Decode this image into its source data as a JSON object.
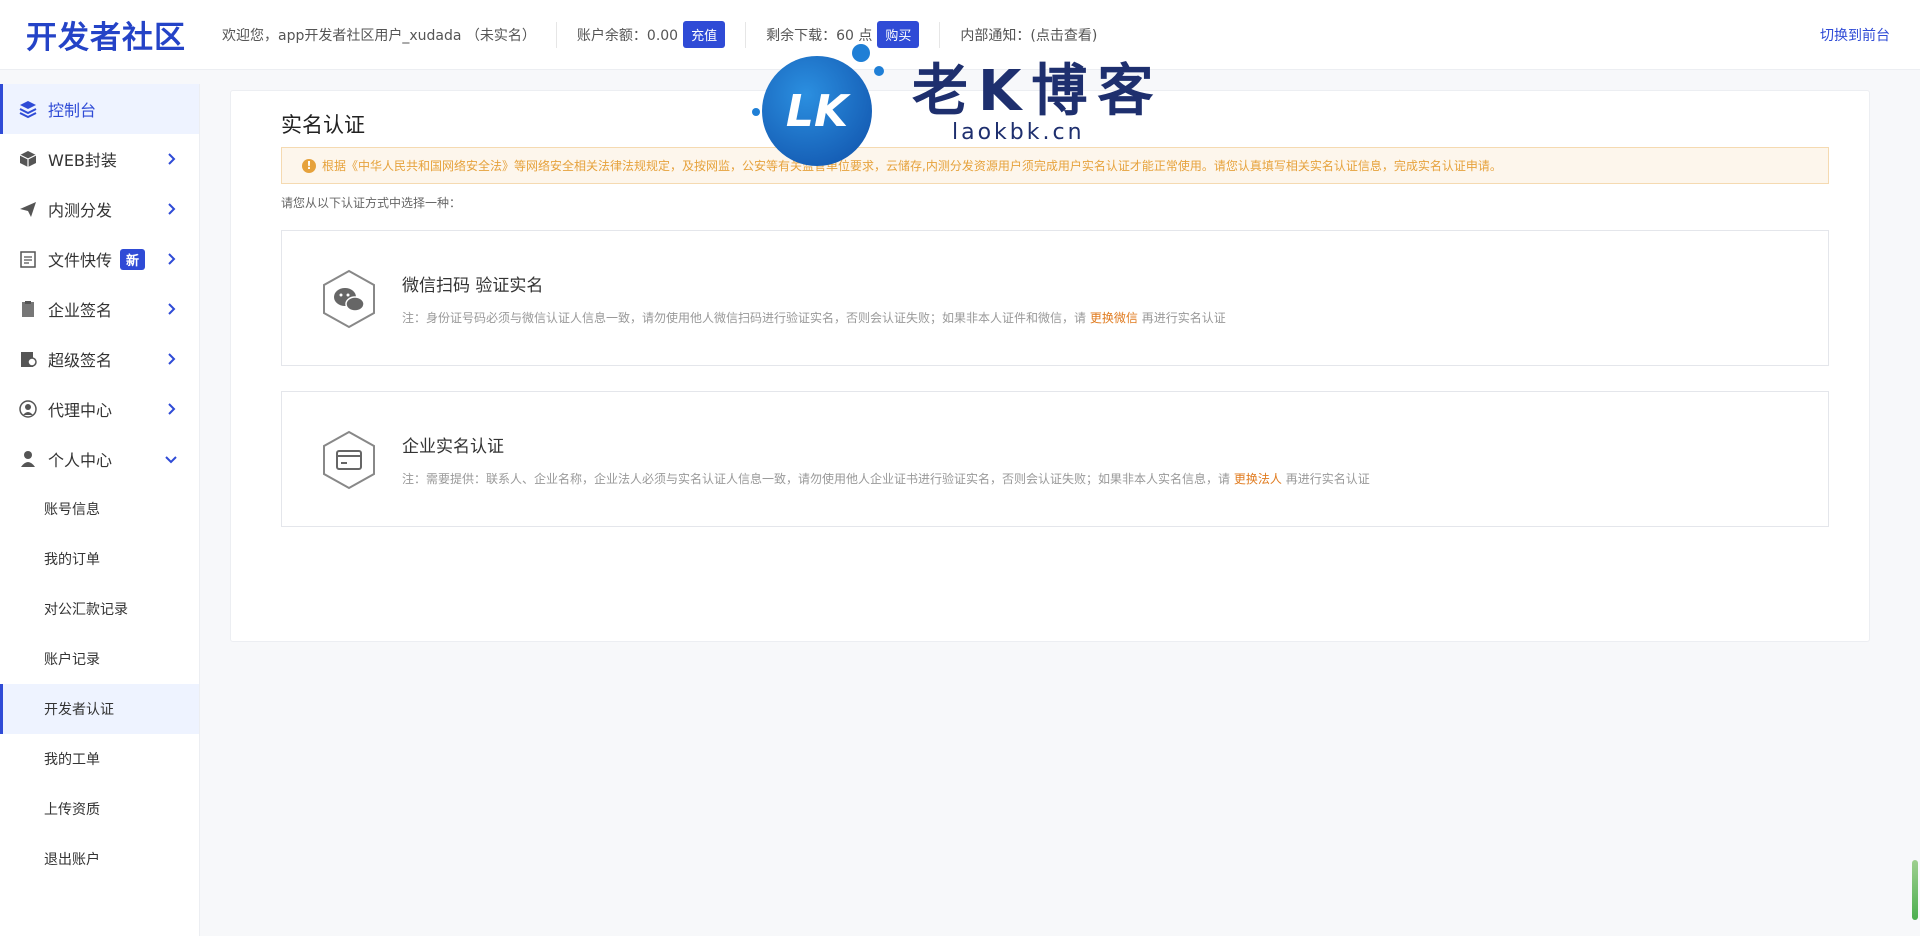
{
  "header": {
    "logo": "开发者社区",
    "welcome": "欢迎您，app开发者社区用户_xudada （未实名）",
    "balance_label": "账户余额：0.00",
    "recharge_btn": "充值",
    "downloads_label": "剩余下载：60 点",
    "buy_btn": "购买",
    "notice_label": "内部通知：(点击查看)",
    "switch_front": "切换到前台"
  },
  "sidebar": {
    "items": [
      {
        "label": "控制台",
        "icon": "layers-icon"
      },
      {
        "label": "WEB封装",
        "icon": "box-icon"
      },
      {
        "label": "内测分发",
        "icon": "paper-plane-icon"
      },
      {
        "label": "文件快传",
        "icon": "file-icon",
        "badge": "新"
      },
      {
        "label": "企业签名",
        "icon": "clipboard-icon"
      },
      {
        "label": "超级签名",
        "icon": "certificate-icon"
      },
      {
        "label": "代理中心",
        "icon": "agent-icon"
      },
      {
        "label": "个人中心",
        "icon": "user-icon"
      }
    ],
    "sub_items": [
      "账号信息",
      "我的订单",
      "对公汇款记录",
      "账户记录",
      "开发者认证",
      "我的工单",
      "上传资质",
      "退出账户"
    ]
  },
  "main": {
    "title": "实名认证",
    "notice": "根据《中华人民共和国网络安全法》等网络安全相关法律法规规定，及按网监，公安等有关监管单位要求，云储存,内测分发资源用户须完成用户实名认证才能正常使用。请您认真填写相关实名认证信息，完成实名认证申请。",
    "choose_tip": "请您从以下认证方式中选择一种：",
    "methods": [
      {
        "title": "微信扫码 验证实名",
        "desc_before": "注：身份证号码必须与微信认证人信息一致，请勿使用他人微信扫码进行验证实名，否则会认证失败；如果非本人证件和微信，请",
        "link": "更换微信",
        "desc_after": "再进行实名认证",
        "icon": "wechat-icon"
      },
      {
        "title": "企业实名认证",
        "desc_before": "注：需要提供：联系人、企业名称，企业法人必须与实名认证人信息一致，请勿使用他人企业证书进行验证实名，否则会认证失败；如果非本人实名信息，请",
        "link": "更换法人",
        "desc_after": "再进行实名认证",
        "icon": "card-icon"
      }
    ]
  },
  "watermark": {
    "badge": "LK",
    "title": "老K博客",
    "url": "laokbk.cn"
  }
}
